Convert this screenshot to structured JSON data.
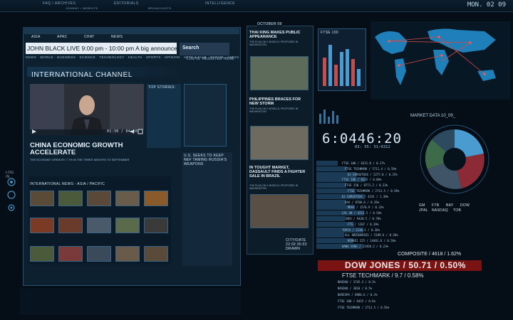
{
  "top_nav": {
    "tab1": "FAQ / ARCHIVES",
    "tab2": "EDITORIALS",
    "tab3": "INTELLIGENCE",
    "sub1": "JOHNNY / WEBSITE",
    "sub2": "BROADCASTS",
    "clock": "MON. 02 09"
  },
  "browser": {
    "tabs": [
      "ASIA",
      "APAC",
      "CHAT",
      "NEWS"
    ],
    "address": "JOHN BLACK LIVE 9:00 pm - 10:00 pm A big announcement",
    "search_label": "Search",
    "login": "LOG IN",
    "register": "REGISTER HERE",
    "nav_links": "NEWS · WORLD · BUSINESS · SCIENCE · TECHNOLOGY · HEALTH · SPORTS · OPINION · ARTS & FILM · ESTATE · AUDIO",
    "channel_title": "INTERNATIONAL CHANNEL",
    "video_time": "01:30 / 04:00",
    "headline": "CHINA ECONOMIC GROWTH ACCELERATE",
    "subline": "THE ECONOMY GREW BY 7.7% IN THE THREE MONTHS TO SEPTEMBER",
    "top_stories": "TOP STORIES:",
    "side_story": "U.S. SEEKS TO KEEP NEF TAMING RUSSIA'S WEAPONS",
    "gallery_label": "INTERNATIONAL NEWS - ASIA / PACIFIC"
  },
  "news_list": {
    "date": "OCTOBER 09",
    "items": [
      {
        "title": "THAI KING MAKES PUBLIC APPEARANCE",
        "sub": "THE PLAN ON 2 MODELS, PROPOSED IN WASHINGTON"
      },
      {
        "title": "PHILIPPINES BRACES FOR NEW STORM",
        "sub": "THE PLAN ON 2 MODELS, PROPOSED IN WASHINGTON"
      },
      {
        "title": "IN TOUGHT MARKET, DASSAULT FINDS A FIGHTER SALE IN BRAZIL",
        "sub": "THE PLAN ON 2 MODELS, PROPOSED IN WASHINGTON"
      }
    ],
    "footer": "CITY/DATE 22:02:35:03 DRAWN"
  },
  "market": {
    "chart_label": "FTSE 100",
    "time": "6:0446:20",
    "subtime": "03: 55: 51:0312",
    "title": "MARKET DATA 10_09_",
    "tickers": [
      {
        "name": "FTSE 100",
        "value": "/ 6231.8 / 0.17%"
      },
      {
        "name": "FTSE TECHMARK",
        "value": "/ 5711.4 / 0.58%"
      },
      {
        "name": "DJ EUROSTOXX",
        "value": "/ 5277.0 / 0.15%"
      },
      {
        "name": "FTSE 100",
        "value": "/ 6235 / 0.06%"
      },
      {
        "name": "FTSE 250",
        "value": "/ 8771.2 / 0.23%"
      },
      {
        "name": "FTSE TECHMARK",
        "value": "/ 2713.5 / 0.58%"
      },
      {
        "name": "DJ EUROSTOXX",
        "value": "/ 4241 / 1.30%"
      },
      {
        "name": "DAX",
        "value": "/ 8708.6 / 0.26%"
      },
      {
        "name": "MDAX",
        "value": "/ 1570.9 / 0.32%"
      },
      {
        "name": "CAC 40",
        "value": "/ 4213.5 / 0.58%"
      },
      {
        "name": "IBEX",
        "value": "/ 9420.5 / 0.78%"
      },
      {
        "name": "FTS",
        "value": "/ 1207 / 0.39%"
      },
      {
        "name": "TOPIX",
        "value": "/ 1130.5 / 0.36%"
      },
      {
        "name": "ALL ORDINARIES",
        "value": "/ 5189.6 / 0.36%"
      },
      {
        "name": "NIKKEI 225",
        "value": "/ 14401.6 / 0.56%"
      },
      {
        "name": "HANG SENG",
        "value": "/ 23450.2 / 0.23%"
      }
    ],
    "composite": "COMPOSITE / 4618 / 1.62%",
    "dow": "DOW JONES / 50.71 / 0.50%",
    "ftse_techmark": "FTSE TECHMARK / 9.7 / 0.58%",
    "bottom_tickers": [
      {
        "name": "NASDAQ",
        "value": "/ 3745.3 / 0.2%"
      },
      {
        "name": "NASDAQ",
        "value": "/ 3810 / 0.5%"
      },
      {
        "name": "BOVESPA",
        "value": "/ 8960.6 / 0.2%"
      },
      {
        "name": "FTSE 100",
        "value": "/ 6435 / 0.6%"
      },
      {
        "name": "FTSE TECHMARK",
        "value": "/ 2713.5 / 0.56%"
      }
    ],
    "legend": [
      "GM",
      "FTB",
      "BAY",
      "DOW",
      "JPAL",
      "NASDAQ",
      "TOB"
    ]
  },
  "colors": {
    "accent": "#2f7fb5",
    "dow_red": "#7a1414",
    "pie_blue": "#4a9cd0",
    "pie_red": "#8c2a36",
    "pie_green": "#3d6b4a",
    "pie_grey": "#3f5466"
  },
  "icons": [
    "wifi-icon",
    "bell-icon",
    "gear-icon",
    "play-icon",
    "volume-icon",
    "fullscreen-icon"
  ]
}
